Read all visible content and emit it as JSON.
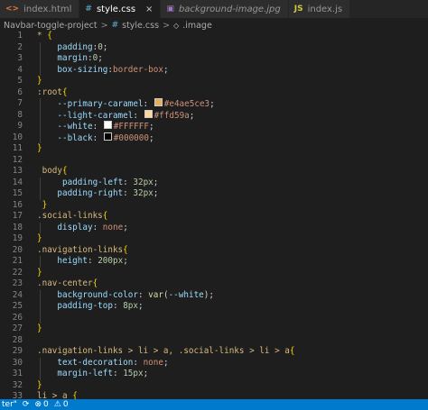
{
  "tabs": [
    {
      "label": "index.html",
      "icon": "html-file-icon",
      "icon_glyph": "<>",
      "active": false,
      "italic": false
    },
    {
      "label": "style.css",
      "icon": "css-file-icon",
      "icon_glyph": "#",
      "active": true,
      "italic": false,
      "close": "×"
    },
    {
      "label": "background-image.jpg",
      "icon": "image-file-icon",
      "icon_glyph": "▣",
      "active": false,
      "italic": true
    },
    {
      "label": "index.js",
      "icon": "js-file-icon",
      "icon_glyph": "JS",
      "active": false,
      "italic": false
    }
  ],
  "breadcrumb": {
    "folder": "Navbar-toggle-project",
    "sep": ">",
    "file_icon": "#",
    "file": "style.css",
    "symbol": ".image"
  },
  "editor": {
    "lines": [
      {
        "n": "1",
        "code": "* {"
      },
      {
        "n": "2",
        "code": "    padding:0;"
      },
      {
        "n": "3",
        "code": "    margin:0;"
      },
      {
        "n": "4",
        "code": "    box-sizing:border-box;"
      },
      {
        "n": "5",
        "code": "}"
      },
      {
        "n": "6",
        "code": ":root{"
      },
      {
        "n": "7",
        "code": "    --primary-caramel: #e4ae5ce3;"
      },
      {
        "n": "8",
        "code": "    --light-caramel: #ffd59a;"
      },
      {
        "n": "9",
        "code": "    --white: #FFFFFF;"
      },
      {
        "n": "10",
        "code": "    --black: #000000;"
      },
      {
        "n": "11",
        "code": "}"
      },
      {
        "n": "12",
        "code": ""
      },
      {
        "n": "13",
        "code": " body{"
      },
      {
        "n": "14",
        "code": "     padding-left: 32px;"
      },
      {
        "n": "15",
        "code": "    padding-right: 32px;"
      },
      {
        "n": "16",
        "code": " }"
      },
      {
        "n": "17",
        "code": ".social-links{"
      },
      {
        "n": "18",
        "code": "    display: none;"
      },
      {
        "n": "19",
        "code": "}"
      },
      {
        "n": "20",
        "code": ".navigation-links{"
      },
      {
        "n": "21",
        "code": "    height: 200px;"
      },
      {
        "n": "22",
        "code": "}"
      },
      {
        "n": "23",
        "code": ".nav-center{"
      },
      {
        "n": "24",
        "code": "    background-color: var(--white);"
      },
      {
        "n": "25",
        "code": "    padding-top: 8px;"
      },
      {
        "n": "26",
        "code": ""
      },
      {
        "n": "27",
        "code": "}"
      },
      {
        "n": "28",
        "code": ""
      },
      {
        "n": "29",
        "code": ".navigation-links > li > a, .social-links > li > a{"
      },
      {
        "n": "30",
        "code": "    text-decoration: none;"
      },
      {
        "n": "31",
        "code": "    margin-left: 15px;"
      },
      {
        "n": "32",
        "code": "}"
      },
      {
        "n": "33",
        "code": "li > a {"
      }
    ]
  },
  "swatches": {
    "primary-caramel": "#e4ae5c",
    "light-caramel": "#ffd59a",
    "white": "#FFFFFF",
    "black": "#000000"
  },
  "statusbar": {
    "left_text": "ter\"",
    "errors": "0",
    "warnings": "0"
  },
  "colors": {
    "accent": "#007acc",
    "editor_bg": "#1e1e1e",
    "selector": "#d7ba7d",
    "property": "#9cdcfe",
    "value": "#ce9178",
    "number": "#b5cea8"
  }
}
